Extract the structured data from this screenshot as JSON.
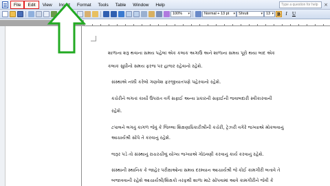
{
  "menu": {
    "items": [
      {
        "label": "File",
        "highlighted": true
      },
      {
        "label": "Edit",
        "highlighted": true
      },
      {
        "label": "View",
        "highlighted": false
      },
      {
        "label": "Insert",
        "highlighted": false
      },
      {
        "label": "Format",
        "highlighted": false
      },
      {
        "label": "Tools",
        "highlighted": false
      },
      {
        "label": "Table",
        "highlighted": false
      },
      {
        "label": "Window",
        "highlighted": false
      },
      {
        "label": "Help",
        "highlighted": false
      }
    ],
    "help_placeholder": "Type a question for help"
  },
  "toolbar": {
    "zoom": "100%",
    "style": "Normal + 13 pt",
    "font": "Shruti",
    "size": "13",
    "accent_color": "#f5c66c"
  },
  "annotation": {
    "type": "up-arrow",
    "color": "#22aa22",
    "points_to": "Format"
  },
  "document": {
    "paragraphs": [
      "શાળાના શરૂ થવાના સમય પહેલાં એક કલાક અગાઉ અને શાળાના સમય પૂરો થયા બાદ એક",
      "કલાક સુધીનો સમય ફરજ પર હાજર રહેવાનો રહેશે.",
      "સંસ્થાએ નક્કી કરેલો ગણવેશ ફરજીયાતપણે પહેરવાનો રહેશે.",
      "કચેરીને લગતાં કાર્યો ઉપરાંત વર્ગ સફાઈ અન્ય પ્રકારની સફાઈની જવાબદારી સ્વીકારવાની",
      "રહેશે.",
      "ટપાલને લગતું કાગળ જેવું કે જિલ્લા શિક્ષણાધિકારીશ્રીની કચેરી, ટ્રેઝરી વગેરે જગ્યાએ મોકલવાનું",
      "આચાર્યશ્રી સોંપે તે કરવાનું રહેશે.",
      "જરૂર પડે તો સંસ્થાનું રાચરચીલું યોગ્ય જગ્યાએ ગોઠવણી કરવાનું કાર્ય કરવાનું રહેશે.",
      "સંસ્થાની સ્થાનિક કે જાહેર પરીક્ષાઓના સમય દરમ્યાન આચાર્યશ્રી જે કોઈ કામગીરી બતાવે તે",
      "બજાવવાની રહેશે આચાર્યશ્રી/શિક્ષકો તરફથી શાળા માટે સોંપવામાં આવે કામગીરીને જેવી કે"
    ]
  }
}
